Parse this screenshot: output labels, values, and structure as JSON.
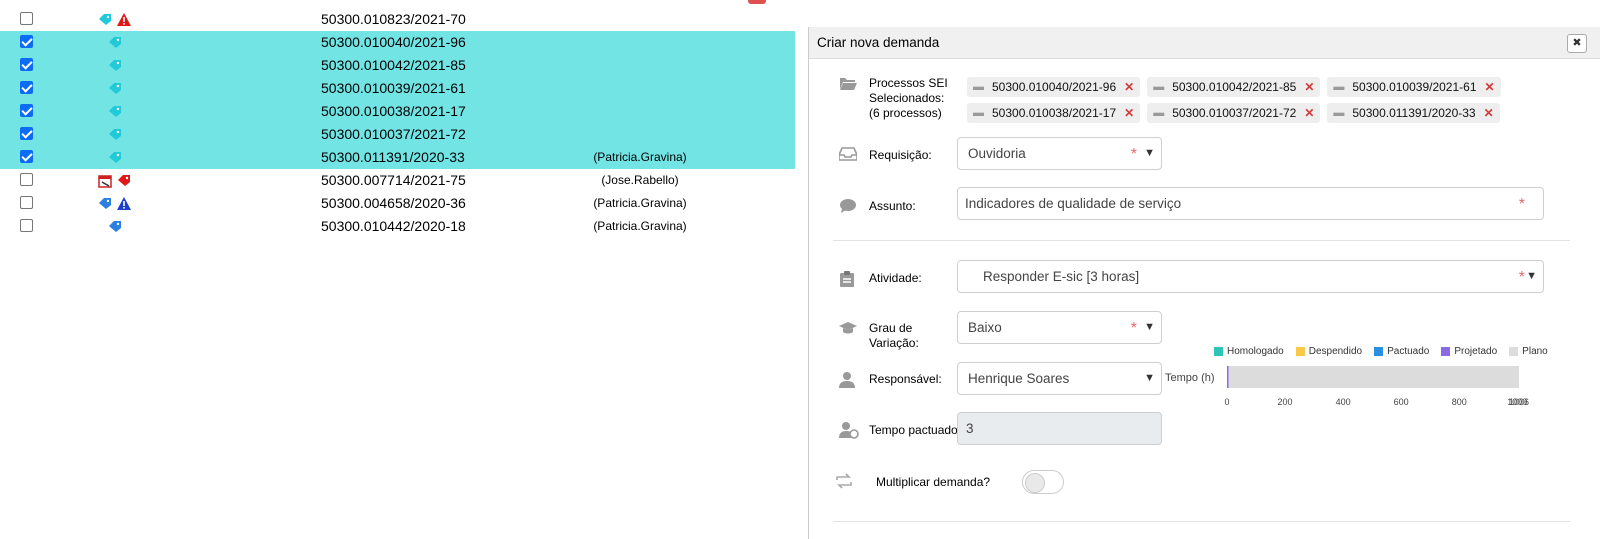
{
  "table": {
    "rows": [
      {
        "checked": false,
        "selected": false,
        "process": "50300.010823/2021-70",
        "user": "",
        "icons": [
          "tag-cyan-icon",
          "warning-red-icon"
        ]
      },
      {
        "checked": true,
        "selected": true,
        "process": "50300.010040/2021-96",
        "user": "",
        "icons": [
          "tag-cyan-icon"
        ]
      },
      {
        "checked": true,
        "selected": true,
        "process": "50300.010042/2021-85",
        "user": "",
        "icons": [
          "tag-cyan-icon"
        ]
      },
      {
        "checked": true,
        "selected": true,
        "process": "50300.010039/2021-61",
        "user": "",
        "icons": [
          "tag-cyan-icon"
        ]
      },
      {
        "checked": true,
        "selected": true,
        "process": "50300.010038/2021-17",
        "user": "",
        "icons": [
          "tag-cyan-icon"
        ]
      },
      {
        "checked": true,
        "selected": true,
        "process": "50300.010037/2021-72",
        "user": "",
        "icons": [
          "tag-cyan-icon"
        ]
      },
      {
        "checked": true,
        "selected": true,
        "process": "50300.011391/2020-33",
        "user": "(Patricia.Gravina)",
        "icons": [
          "tag-cyan-icon"
        ]
      },
      {
        "checked": false,
        "selected": false,
        "process": "50300.007714/2021-75",
        "user": "(Jose.Rabello)",
        "icons": [
          "calendar-icon",
          "tag-red-icon"
        ]
      },
      {
        "checked": false,
        "selected": false,
        "process": "50300.004658/2020-36",
        "user": "(Patricia.Gravina)",
        "icons": [
          "tag-blue-icon",
          "warning-blue-icon"
        ]
      },
      {
        "checked": false,
        "selected": false,
        "process": "50300.010442/2020-18",
        "user": "(Patricia.Gravina)",
        "icons": [
          "tag-blue-icon"
        ]
      }
    ]
  },
  "dialog": {
    "title": "Criar nova demanda",
    "close_icon": "close-icon",
    "processos": {
      "label_line1": "Processos SEI",
      "label_line2": "Selecionados:",
      "label_line3": "(6 processos)",
      "chips": [
        "50300.010040/2021-96",
        "50300.010042/2021-85",
        "50300.010039/2021-61",
        "50300.010038/2021-17",
        "50300.010037/2021-72",
        "50300.011391/2020-33"
      ]
    },
    "requisicao": {
      "label": "Requisição:",
      "value": "Ouvidoria"
    },
    "assunto": {
      "label": "Assunto:",
      "value": "Indicadores de qualidade de serviço"
    },
    "atividade": {
      "label": "Atividade:",
      "value": "Responder E-sic [3 horas]"
    },
    "grau": {
      "label_line1": "Grau de",
      "label_line2": "Variação:",
      "value": "Baixo"
    },
    "responsavel": {
      "label": "Responsável:",
      "value": "Henrique Soares"
    },
    "tempo_pactuado": {
      "label": "Tempo pactuado:",
      "value": "3"
    },
    "multiplicar": {
      "label": "Multiplicar demanda?",
      "enabled": false
    }
  },
  "chart_data": {
    "type": "bar",
    "categories": [
      "Tempo (h)"
    ],
    "series": [
      {
        "name": "Homologado",
        "color": "#2ec4b6",
        "values": [
          0
        ]
      },
      {
        "name": "Despendido",
        "color": "#f8c94a",
        "values": [
          0
        ]
      },
      {
        "name": "Pactuado",
        "color": "#2b8fe0",
        "values": [
          0
        ]
      },
      {
        "name": "Projetado",
        "color": "#8a6be6",
        "values": [
          3
        ]
      },
      {
        "name": "Plano",
        "color": "#dcdcdc",
        "values": [
          1006
        ]
      }
    ],
    "xticks": [
      "0",
      "200",
      "400",
      "600",
      "800",
      "1000",
      "1006"
    ],
    "xlim": [
      0,
      1006
    ],
    "legend": "top"
  }
}
